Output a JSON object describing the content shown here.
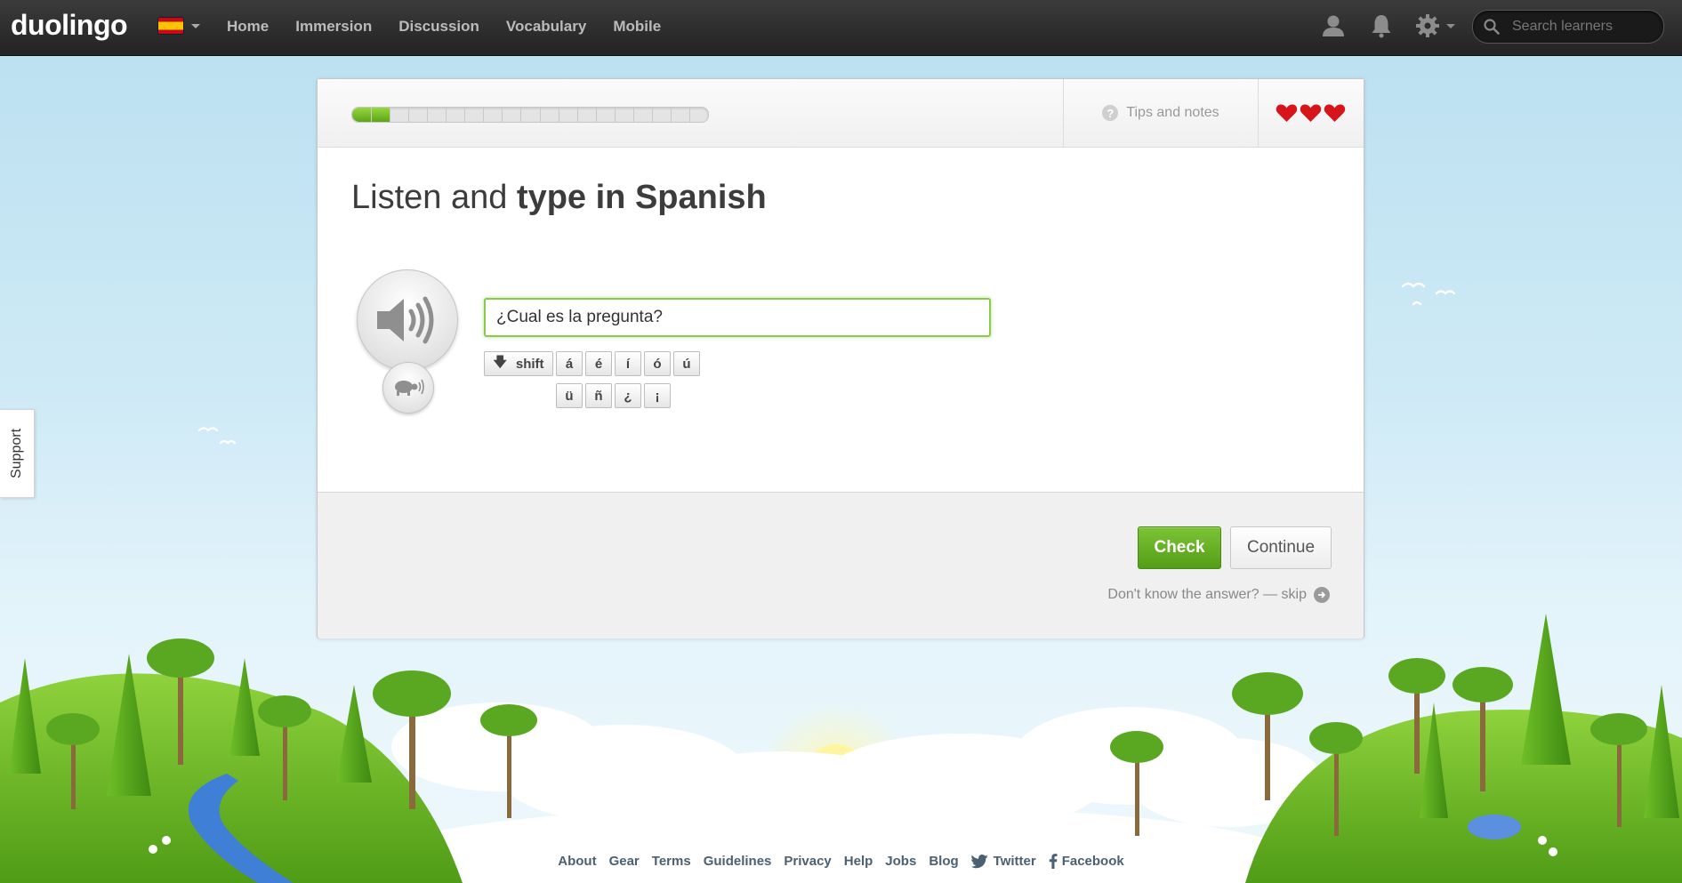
{
  "brand": {
    "logo_text": "duolingo"
  },
  "nav": {
    "items": [
      "Home",
      "Immersion",
      "Discussion",
      "Vocabulary",
      "Mobile"
    ]
  },
  "search": {
    "placeholder": "Search learners"
  },
  "support": {
    "label": "Support"
  },
  "lesson": {
    "progress": {
      "completed": 2,
      "total": 19
    },
    "tips_label": "Tips and notes",
    "hearts": 3,
    "prompt_normal": "Listen and ",
    "prompt_bold": "type in Spanish",
    "answer_value": "¿Cual es la pregunta?",
    "keyboard": {
      "shift_label": "shift",
      "row1": [
        "á",
        "é",
        "í",
        "ó",
        "ú"
      ],
      "row2": [
        "ü",
        "ñ",
        "¿",
        "¡"
      ]
    },
    "check_label": "Check",
    "continue_label": "Continue",
    "skip_label": "Don't know the answer? — skip"
  },
  "footer": {
    "links": [
      "About",
      "Gear",
      "Terms",
      "Guidelines",
      "Privacy",
      "Help",
      "Jobs",
      "Blog",
      "Twitter",
      "Facebook"
    ]
  },
  "colors": {
    "accent_green": "#5ca614",
    "heart_red": "#d8141b",
    "topbar": "#2b2b2b"
  }
}
